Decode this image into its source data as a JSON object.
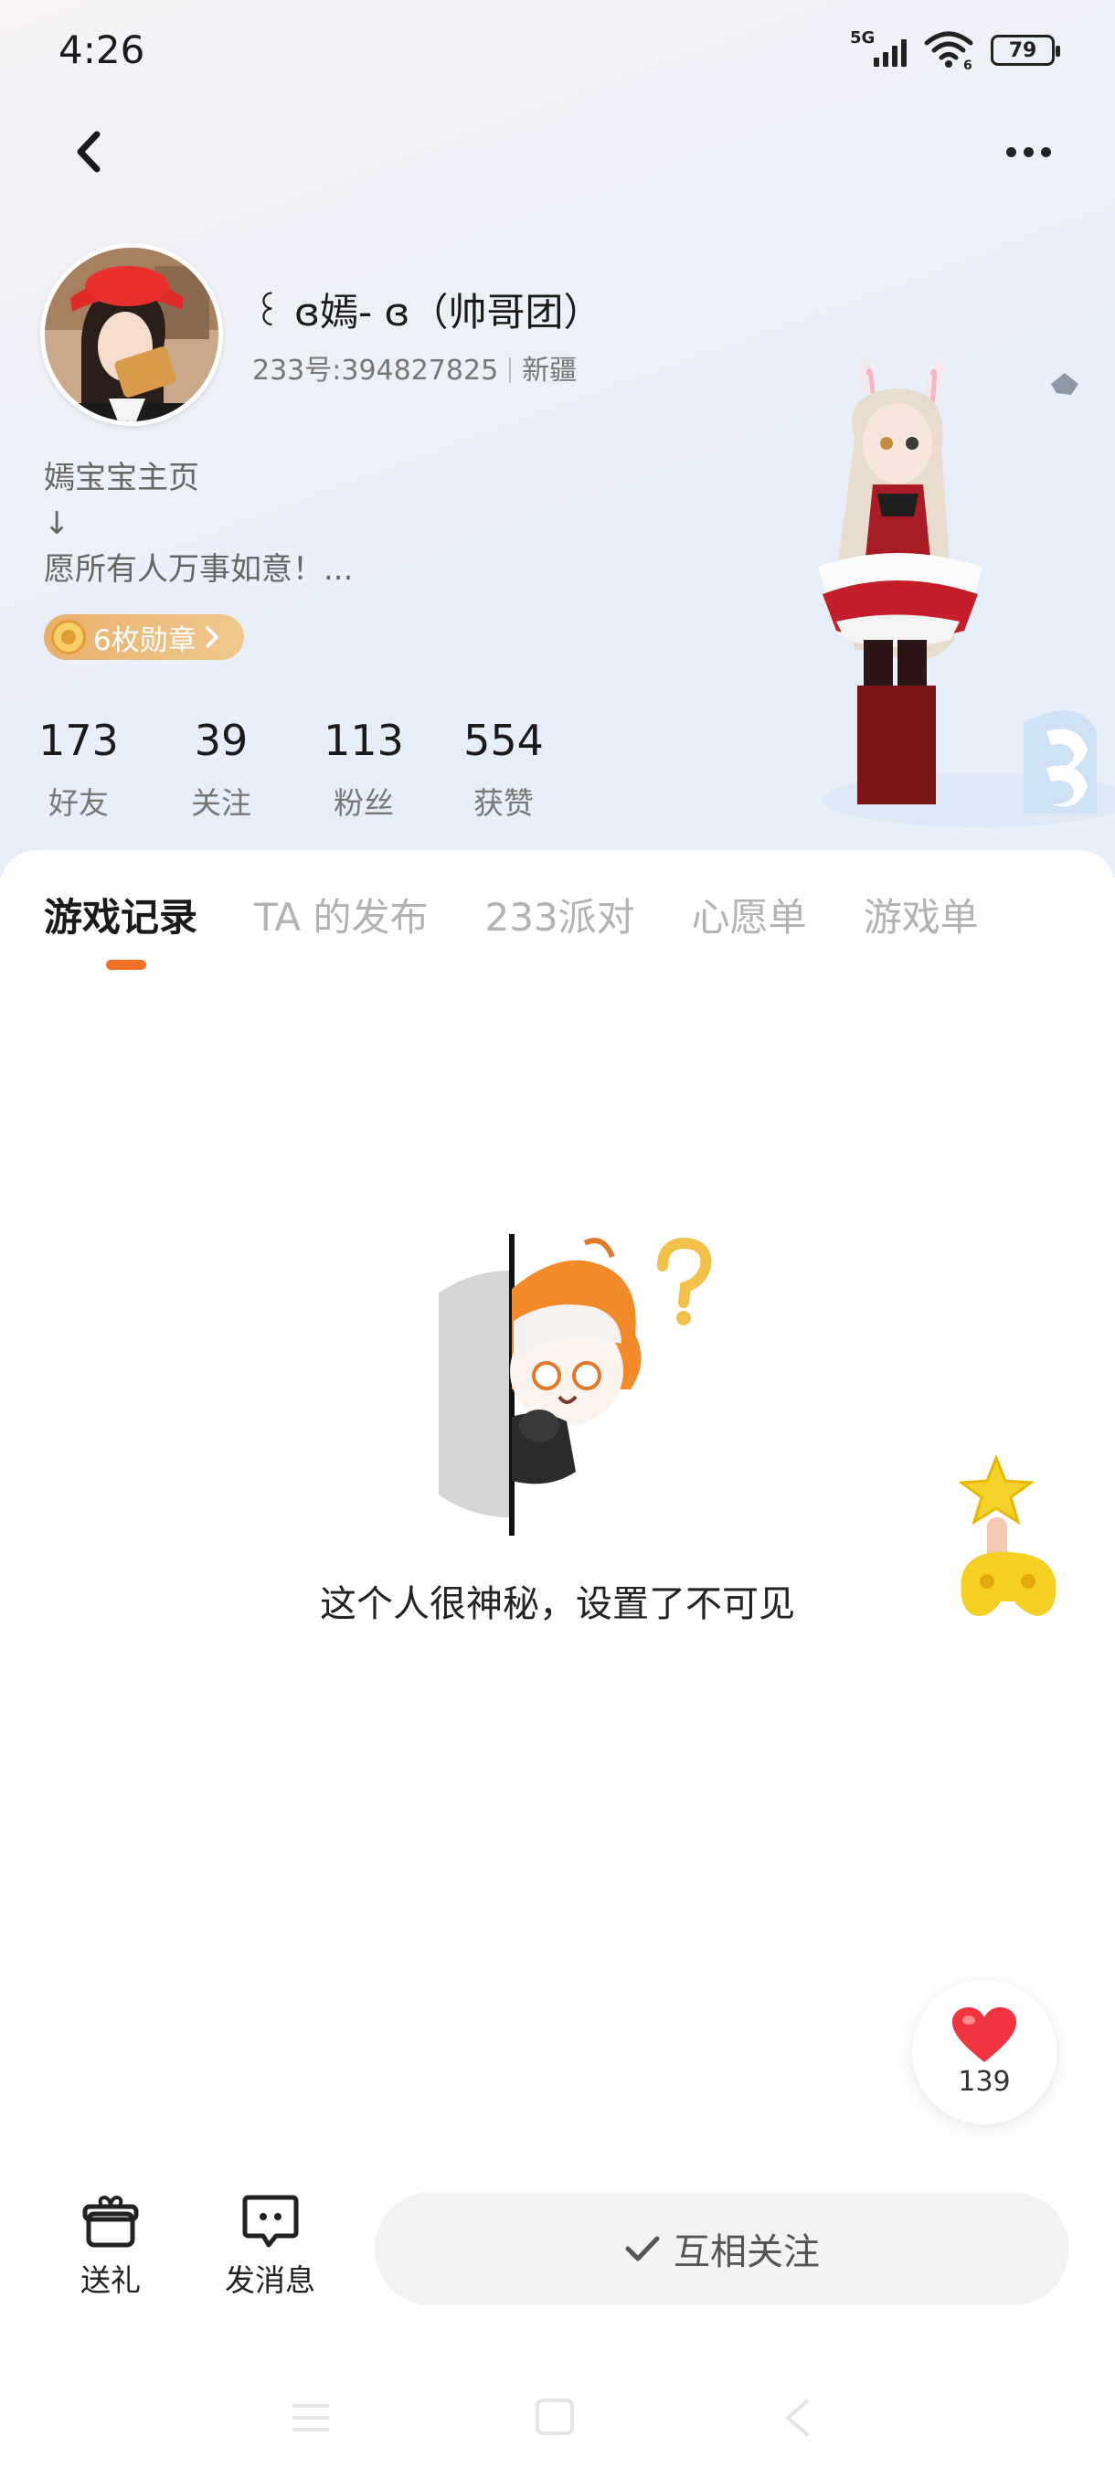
{
  "status_bar": {
    "time": "4:26",
    "network": "5G",
    "wifi_label": "6",
    "battery": "79"
  },
  "profile": {
    "nickname": "꒰ ɞ嫣- ɞ（帅哥团）",
    "uid_text": "233号:394827825",
    "region": "新疆",
    "bio_lines": [
      "嫣宝宝主页",
      "↓",
      "愿所有人万事如意！..."
    ],
    "medal_label": "6枚勋章",
    "stats": [
      {
        "value": "173",
        "label": "好友"
      },
      {
        "value": "39",
        "label": "关注"
      },
      {
        "value": "113",
        "label": "粉丝"
      },
      {
        "value": "554",
        "label": "获赞"
      }
    ]
  },
  "tabs": [
    "游戏记录",
    "TA 的发布",
    "233派对",
    "心愿单",
    "游戏单"
  ],
  "active_tab": "游戏记录",
  "empty_state": {
    "message": "这个人很神秘，设置了不可见"
  },
  "like": {
    "count": "139"
  },
  "bottom_bar": {
    "gift_label": "送礼",
    "message_label": "发消息",
    "follow_label": "互相关注"
  },
  "colors": {
    "accent": "#f27024",
    "medal": "#e8b06c",
    "heart": "#f0353f"
  }
}
